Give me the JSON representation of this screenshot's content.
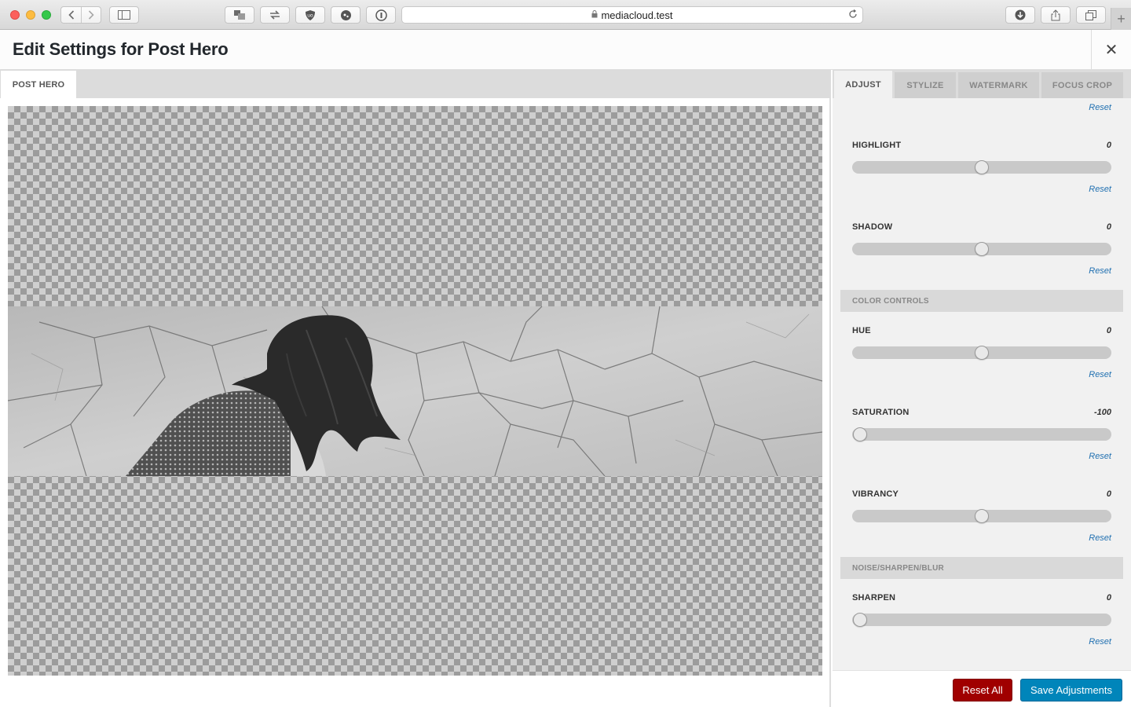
{
  "browser": {
    "url": "mediacloud.test"
  },
  "modal": {
    "title": "Edit Settings for Post Hero",
    "close_symbol": "✕"
  },
  "left_tabs": [
    {
      "label": "POST HERO",
      "active": true
    }
  ],
  "right_tabs": [
    {
      "label": "ADJUST",
      "active": true
    },
    {
      "label": "STYLIZE",
      "active": false
    },
    {
      "label": "WATERMARK",
      "active": false
    },
    {
      "label": "FOCUS CROP",
      "active": false
    }
  ],
  "reset_label": "Reset",
  "controls": {
    "highlight": {
      "label": "HIGHLIGHT",
      "value": "0",
      "level": 0.5
    },
    "shadow": {
      "label": "SHADOW",
      "value": "0",
      "level": 0.5
    },
    "hue": {
      "label": "HUE",
      "value": "0",
      "level": 0.5
    },
    "saturation": {
      "label": "SATURATION",
      "value": "-100",
      "level": 0.0
    },
    "vibrancy": {
      "label": "VIBRANCY",
      "value": "0",
      "level": 0.5
    },
    "sharpen": {
      "label": "SHARPEN",
      "value": "0",
      "level": 0.0
    }
  },
  "sections": {
    "color": "COLOR CONTROLS",
    "noise": "NOISE/SHARPEN/BLUR"
  },
  "footer": {
    "reset_all": "Reset All",
    "save": "Save Adjustments"
  },
  "icons": {
    "back": "chevron-left-icon",
    "forward": "chevron-right-icon",
    "sidebar": "sidebar-icon",
    "lock": "lock-icon",
    "reload": "reload-icon",
    "download": "download-icon",
    "share": "share-icon",
    "tabs": "tabs-icon",
    "new_tab": "plus-icon"
  },
  "colors": {
    "accent": "#0085ba",
    "danger": "#a00000",
    "link": "#2271b1"
  }
}
